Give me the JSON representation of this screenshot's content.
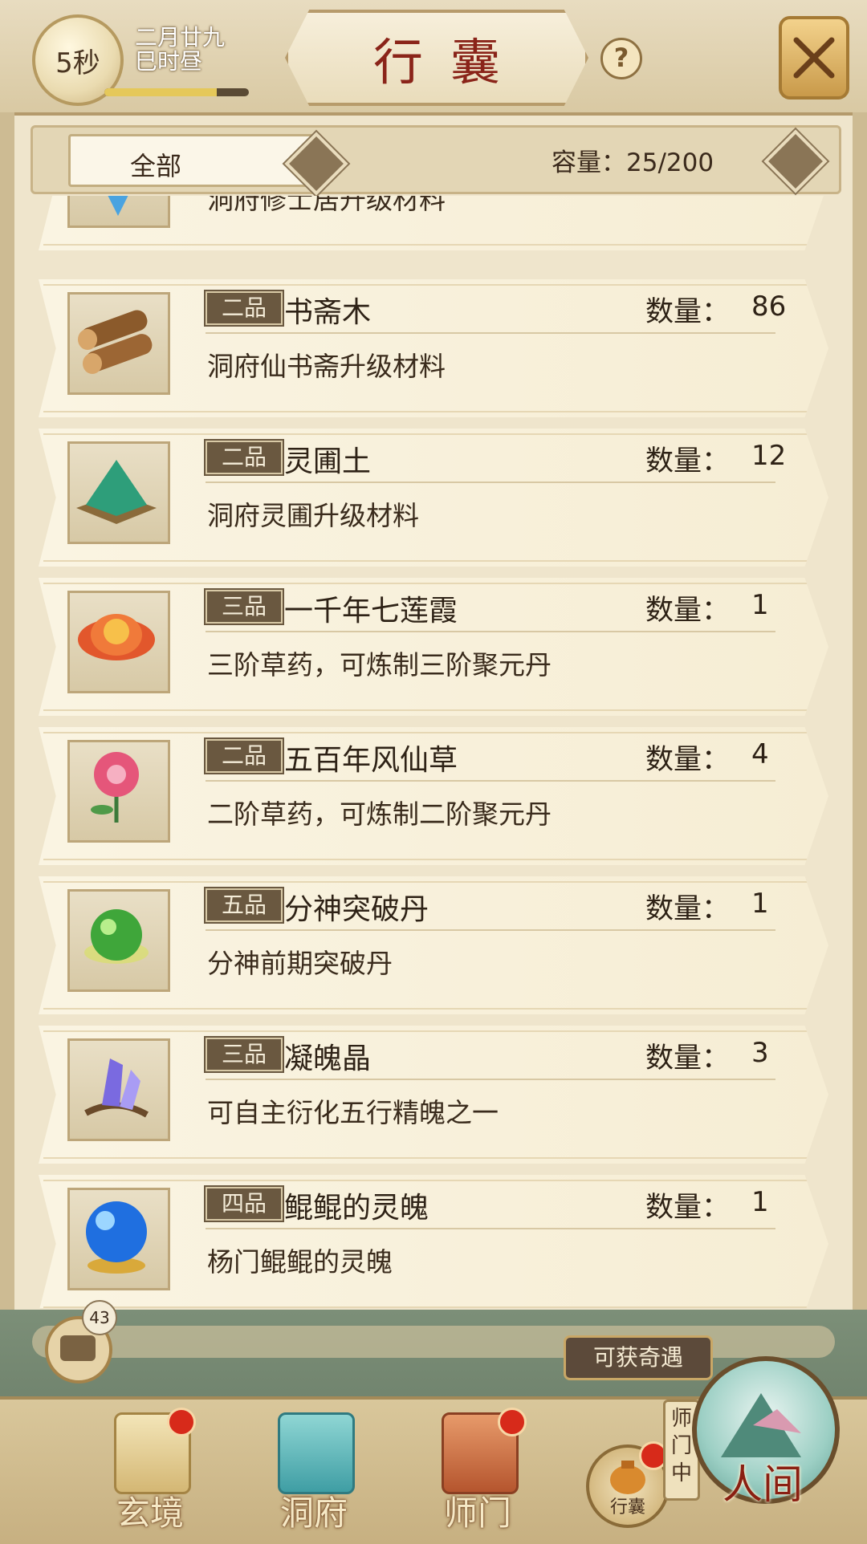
{
  "header": {
    "timer": "5秒",
    "date_line1": "二月廿九",
    "date_line2": "巳时昼",
    "time_progress": 0.78,
    "title": "行囊",
    "help": "?"
  },
  "filter": {
    "selected": "全部",
    "capacity": "容量：25/200"
  },
  "items": [
    {
      "grade": "",
      "name": "",
      "quantity_label": "",
      "quantity": "",
      "desc": "洞府修士居升级材料",
      "icon": "blue-crystal-icon"
    },
    {
      "grade": "二品",
      "name": "书斋木",
      "quantity_label": "数量：",
      "quantity": "86",
      "desc": "洞府仙书斋升级材料",
      "icon": "wood-logs-icon"
    },
    {
      "grade": "二品",
      "name": "灵圃土",
      "quantity_label": "数量：",
      "quantity": "12",
      "desc": "洞府灵圃升级材料",
      "icon": "green-soil-icon"
    },
    {
      "grade": "三品",
      "name": "一千年七莲霞",
      "quantity_label": "数量：",
      "quantity": "1",
      "desc": "三阶草药，可炼制三阶聚元丹",
      "icon": "orange-lotus-icon"
    },
    {
      "grade": "二品",
      "name": "五百年风仙草",
      "quantity_label": "数量：",
      "quantity": "4",
      "desc": "二阶草药，可炼制二阶聚元丹",
      "icon": "pink-flower-icon"
    },
    {
      "grade": "五品",
      "name": "分神突破丹",
      "quantity_label": "数量：",
      "quantity": "1",
      "desc": "分神前期突破丹",
      "icon": "green-pill-icon"
    },
    {
      "grade": "三品",
      "name": "凝魄晶",
      "quantity_label": "数量：",
      "quantity": "3",
      "desc": "可自主衍化五行精魄之一",
      "icon": "purple-crystal-icon"
    },
    {
      "grade": "四品",
      "name": "鲲鲲的灵魄",
      "quantity_label": "数量：",
      "quantity": "1",
      "desc": "杨门鲲鲲的灵魄",
      "icon": "blue-orb-icon"
    }
  ],
  "chat": {
    "badge": "43"
  },
  "event_tag": "可获奇遇",
  "nav": {
    "xuanjing": "玄境",
    "dongfu": "洞府",
    "shimen": "师门",
    "bag": "行囊",
    "sect_status": "师门中",
    "world": "人间"
  },
  "colors": {
    "title_red": "#8a2419",
    "grade_bg": "#6a5840",
    "notify_red": "#d72a1a",
    "panel_bg": "#faf4e2"
  }
}
